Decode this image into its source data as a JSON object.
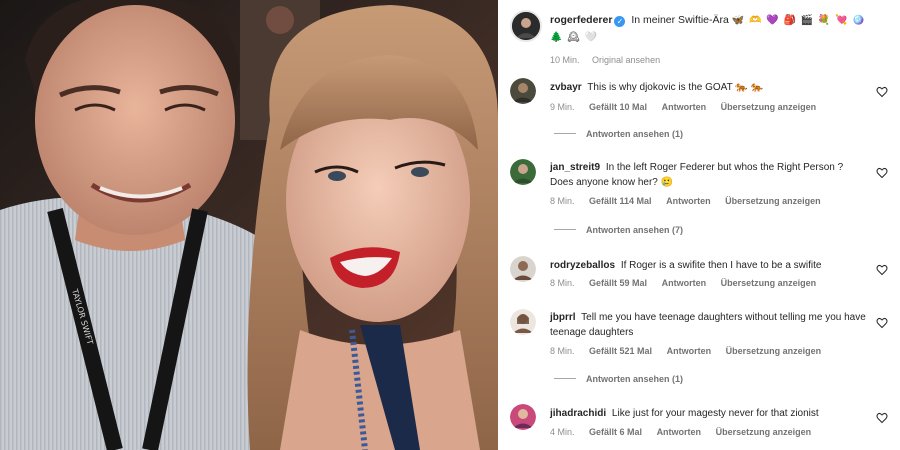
{
  "post": {
    "username": "rogerfederer",
    "caption": "In meiner Swiftie-Ära",
    "caption_emojis": "🦋 🫶 💜 🎒 🎬 💐 💘 🪩",
    "caption_emojis_line2": "🌲 🕰 🤍",
    "time": "10 Min.",
    "see_original": "Original ansehen"
  },
  "comments": [
    {
      "username": "zvbayr",
      "text": "This is why djokovic is the GOAT 🐅 🐅",
      "time": "9 Min.",
      "likes": "Gefällt 10 Mal",
      "reply": "Antworten",
      "translate": "Übersetzung anzeigen",
      "view_replies": "Antworten ansehen (1)"
    },
    {
      "username": "jan_streit9",
      "text": "In the left Roger Federer but whos the Right Person ? Does anyone know her? 🥲",
      "time": "8 Min.",
      "likes": "Gefällt 114 Mal",
      "reply": "Antworten",
      "translate": "Übersetzung anzeigen",
      "view_replies": "Antworten ansehen (7)"
    },
    {
      "username": "rodryzeballos",
      "text": "If Roger is a swifite then I have to be a swifite",
      "time": "8 Min.",
      "likes": "Gefällt 59 Mal",
      "reply": "Antworten",
      "translate": "Übersetzung anzeigen"
    },
    {
      "username": "jbprrl",
      "text": "Tell me you have teenage daughters without telling me you have teenage daughters",
      "time": "8 Min.",
      "likes": "Gefällt 521 Mal",
      "reply": "Antworten",
      "translate": "Übersetzung anzeigen",
      "view_replies": "Antworten ansehen (1)"
    },
    {
      "username": "jihadrachidi",
      "text": "Like just for your magesty never for that zionist",
      "time": "4 Min.",
      "likes": "Gefällt 6 Mal",
      "reply": "Antworten",
      "translate": "Übersetzung anzeigen"
    }
  ],
  "photo": {
    "lanyard_text": "TAYLOR SWIFT"
  },
  "colors": {
    "verified": "#3897f0",
    "muted": "#8e8e8e",
    "text": "#262626"
  }
}
